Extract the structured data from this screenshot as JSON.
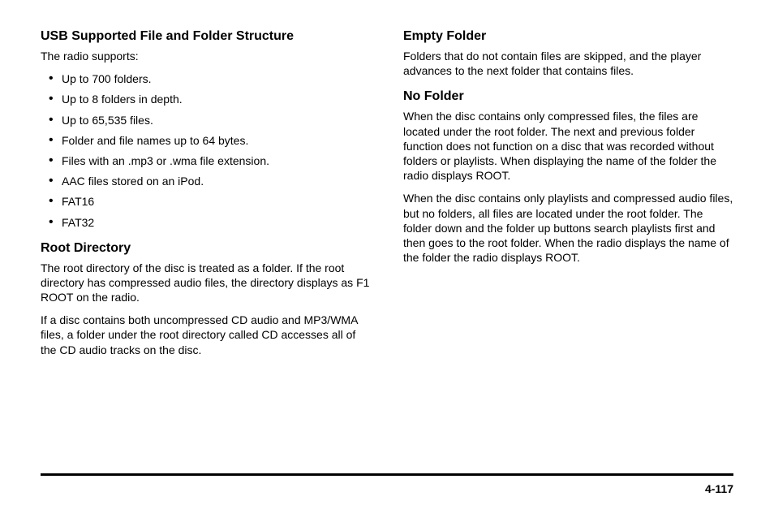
{
  "left": {
    "usb": {
      "heading": "USB Supported File and Folder Structure",
      "intro": "The radio supports:",
      "items": [
        "Up to 700 folders.",
        "Up to 8 folders in depth.",
        "Up to 65,535 files.",
        "Folder and file names up to 64 bytes.",
        "Files with an .mp3 or .wma file extension.",
        "AAC files stored on an iPod.",
        "FAT16",
        "FAT32"
      ]
    },
    "root": {
      "heading": "Root Directory",
      "p1": "The root directory of the disc is treated as a folder. If the root directory has compressed audio files, the directory displays as F1 ROOT on the radio.",
      "p2": "If a disc contains both uncompressed CD audio and MP3/WMA files, a folder under the root directory called CD accesses all of the CD audio tracks on the disc."
    }
  },
  "right": {
    "empty": {
      "heading": "Empty Folder",
      "p1": "Folders that do not contain files are skipped, and the player advances to the next folder that contains files."
    },
    "nofolder": {
      "heading": "No Folder",
      "p1": "When the disc contains only compressed files, the files are located under the root folder. The next and previous folder function does not function on a disc that was recorded without folders or playlists. When displaying the name of the folder the radio displays ROOT.",
      "p2": "When the disc contains only playlists and compressed audio files, but no folders, all files are located under the root folder. The folder down and the folder up buttons search playlists first and then goes to the root folder. When the radio displays the name of the folder the radio displays ROOT."
    }
  },
  "page_number": "4-117"
}
